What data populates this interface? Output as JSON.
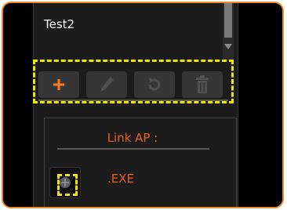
{
  "list": {
    "items": [
      "Test2"
    ]
  },
  "toolbar": {
    "buttons": [
      {
        "icon": "plus-icon",
        "enabled": true,
        "color": "#ff7a1a"
      },
      {
        "icon": "pencil-icon",
        "enabled": false,
        "color": "#505050"
      },
      {
        "icon": "refresh-icon",
        "enabled": false,
        "color": "#505050"
      },
      {
        "icon": "trash-icon",
        "enabled": false,
        "color": "#505050"
      }
    ]
  },
  "link_section": {
    "title": "Link AP :",
    "item": {
      "label": ".EXE",
      "icon": "circle-plus-icon"
    }
  },
  "colors": {
    "frame_border": "#e8892f",
    "highlight": "#f2e600",
    "accent_text": "#e8601c",
    "background": "#000000",
    "panel": "#1c1c1c"
  }
}
